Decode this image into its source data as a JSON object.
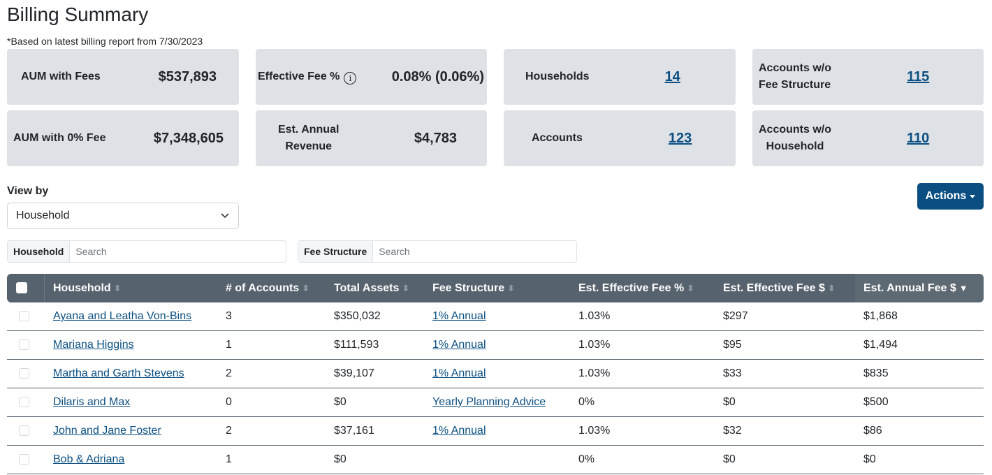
{
  "page": {
    "title": "Billing Summary",
    "subtitle": "*Based on latest billing report from 7/30/2023"
  },
  "cards": {
    "aum_with_fees": {
      "label": "AUM with Fees",
      "value": "$537,893"
    },
    "effective_fee": {
      "label": "Effective Fee %",
      "info_icon": "info-circle-icon",
      "value": "0.08% (0.06%)"
    },
    "households": {
      "label": "Households",
      "value": "14"
    },
    "accounts_wo_fee": {
      "label_line1": "Accounts w/o",
      "label_line2": "Fee Structure",
      "value": "115"
    },
    "aum_zero_fee": {
      "label": "AUM with 0% Fee",
      "value": "$7,348,605"
    },
    "est_annual_revenue": {
      "label_line1": "Est. Annual",
      "label_line2": "Revenue",
      "value": "$4,783"
    },
    "accounts": {
      "label": "Accounts",
      "value": "123"
    },
    "accounts_wo_household": {
      "label_line1": "Accounts w/o",
      "label_line2": "Household",
      "value": "110"
    }
  },
  "view_by": {
    "label": "View by",
    "selected": "Household"
  },
  "actions": {
    "label": "Actions"
  },
  "filters": {
    "household": {
      "prefix": "Household",
      "placeholder": "Search",
      "value": ""
    },
    "fee_structure": {
      "prefix": "Fee Structure",
      "placeholder": "Search",
      "value": ""
    }
  },
  "table": {
    "columns": [
      "Household",
      "# of Accounts",
      "Total Assets",
      "Fee Structure",
      "Est. Effective Fee %",
      "Est. Effective Fee $",
      "Est. Annual Fee $"
    ],
    "sorted_column": "Est. Annual Fee $",
    "sort_direction": "desc",
    "rows": [
      {
        "household": "Ayana and Leatha Von-Bins",
        "accounts": "3",
        "total_assets": "$350,032",
        "fee_structure": "1% Annual",
        "eff_fee_pct": "1.03%",
        "eff_fee_usd": "$297",
        "annual_fee": "$1,868"
      },
      {
        "household": "Mariana Higgins",
        "accounts": "1",
        "total_assets": "$111,593",
        "fee_structure": "1% Annual",
        "eff_fee_pct": "1.03%",
        "eff_fee_usd": "$95",
        "annual_fee": "$1,494"
      },
      {
        "household": "Martha and Garth Stevens",
        "accounts": "2",
        "total_assets": "$39,107",
        "fee_structure": "1% Annual",
        "eff_fee_pct": "1.03%",
        "eff_fee_usd": "$33",
        "annual_fee": "$835"
      },
      {
        "household": "Dilaris and Max",
        "accounts": "0",
        "total_assets": "$0",
        "fee_structure": "Yearly Planning Advice",
        "eff_fee_pct": "0%",
        "eff_fee_usd": "$0",
        "annual_fee": "$500"
      },
      {
        "household": "John and Jane Foster",
        "accounts": "2",
        "total_assets": "$37,161",
        "fee_structure": "1% Annual",
        "eff_fee_pct": "1.03%",
        "eff_fee_usd": "$32",
        "annual_fee": "$86"
      },
      {
        "household": "Bob & Adriana",
        "accounts": "1",
        "total_assets": "$0",
        "fee_structure": "",
        "eff_fee_pct": "0%",
        "eff_fee_usd": "$0",
        "annual_fee": "$0"
      }
    ]
  },
  "colors": {
    "primary": "#0b4f82",
    "card_bg": "#dee1e5",
    "table_header": "#56626d"
  }
}
